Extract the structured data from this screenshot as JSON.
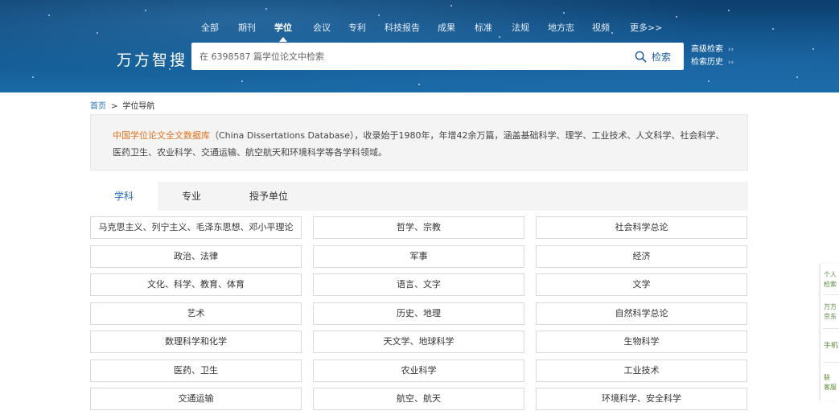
{
  "nav": {
    "items": [
      {
        "label": "全部",
        "active": false
      },
      {
        "label": "期刊",
        "active": false
      },
      {
        "label": "学位",
        "active": true
      },
      {
        "label": "会议",
        "active": false
      },
      {
        "label": "专利",
        "active": false
      },
      {
        "label": "科技报告",
        "active": false
      },
      {
        "label": "成果",
        "active": false
      },
      {
        "label": "标准",
        "active": false
      },
      {
        "label": "法规",
        "active": false
      },
      {
        "label": "地方志",
        "active": false
      },
      {
        "label": "视频",
        "active": false
      },
      {
        "label": "更多>>",
        "active": false
      }
    ]
  },
  "logo": "万方智搜",
  "search": {
    "placeholder": "在 6398587 篇学位论文中检索",
    "button_label": "检索"
  },
  "side_links": {
    "advanced": "高级检索",
    "history": "检索历史",
    "chevron": "››"
  },
  "breadcrumb": {
    "home": "首页",
    "separator": ">",
    "current": "学位导航"
  },
  "intro": {
    "db_name": "中国学位论文全文数据库",
    "text": "（China Dissertations Database），收录始于1980年，年增42余万篇，涵盖基础科学、理学、工业技术、人文科学、社会科学、医药卫生、农业科学、交通运输、航空航天和环境科学等各学科领域。"
  },
  "tabs": [
    {
      "label": "学科",
      "active": true
    },
    {
      "label": "专业",
      "active": false
    },
    {
      "label": "授予单位",
      "active": false
    }
  ],
  "subjects": [
    "马克思主义、列宁主义、毛泽东思想、邓小平理论",
    "哲学、宗教",
    "社会科学总论",
    "政治、法律",
    "军事",
    "经济",
    "文化、科学、教育、体育",
    "语言、文字",
    "文学",
    "艺术",
    "历史、地理",
    "自然科学总论",
    "数理科学和化学",
    "天文学、地球科学",
    "生物科学",
    "医药、卫生",
    "农业科学",
    "工业技术",
    "交通运输",
    "航空、航天",
    "环境科学、安全科学"
  ],
  "float_bar": {
    "items": [
      "个人",
      "检索",
      "万方",
      "京东",
      "手机",
      "联",
      "客服"
    ]
  },
  "colors": {
    "accent_blue": "#2a6db5",
    "db_orange": "#e0731e",
    "header_dark": "#0d3f6e"
  },
  "icons": {
    "search": "magnifier-icon"
  }
}
